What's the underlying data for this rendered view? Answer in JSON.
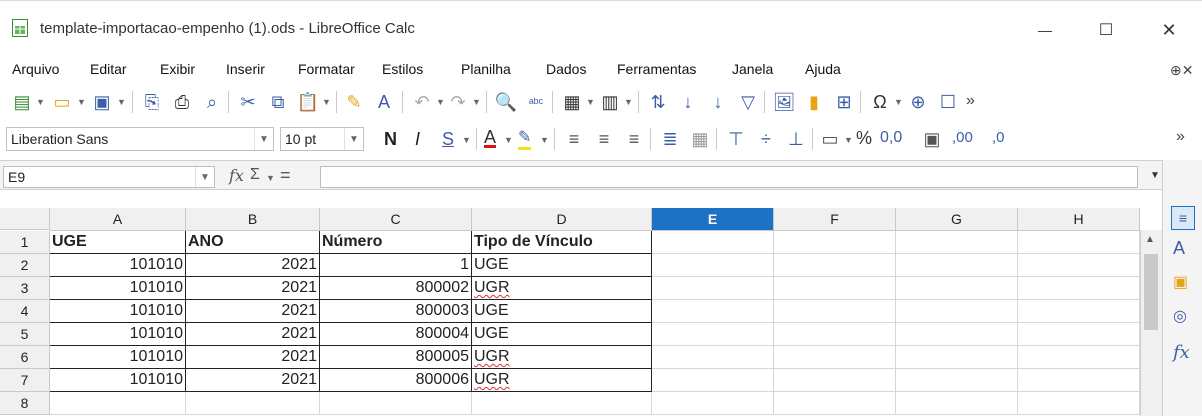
{
  "window": {
    "title": "template-importacao-empenho (1).ods - LibreOffice Calc",
    "controls": {
      "minimize": "—",
      "maximize": "☐",
      "close": "✕"
    }
  },
  "menu": [
    {
      "label": "Arquivo"
    },
    {
      "label": "Editar"
    },
    {
      "label": "Exibir"
    },
    {
      "label": "Inserir"
    },
    {
      "label": "Formatar"
    },
    {
      "label": "Estilos"
    },
    {
      "label": "Planilha"
    },
    {
      "label": "Dados"
    },
    {
      "label": "Ferramentas"
    },
    {
      "label": "Janela"
    },
    {
      "label": "Ajuda"
    }
  ],
  "formatting": {
    "font_name": "Liberation Sans",
    "font_size": "10 pt",
    "bold": "N",
    "italic": "I",
    "underline": "S",
    "percent": "%",
    "decimal_format": "0,0",
    "add_decimal": ",00",
    "del_decimal": ",0"
  },
  "formula_bar": {
    "cell_ref": "E9",
    "fx": "fx",
    "sum": "Σ",
    "equals": "=",
    "content": ""
  },
  "grid": {
    "columns": [
      "A",
      "B",
      "C",
      "D",
      "E",
      "F",
      "G",
      "H"
    ],
    "selected_column": "E",
    "rows": [
      {
        "num": "1",
        "cells": [
          "UGE",
          "ANO",
          "Número",
          "Tipo de Vínculo"
        ]
      },
      {
        "num": "2",
        "cells": [
          "101010",
          "2021",
          "1",
          "UGE"
        ]
      },
      {
        "num": "3",
        "cells": [
          "101010",
          "2021",
          "800002",
          "UGR"
        ]
      },
      {
        "num": "4",
        "cells": [
          "101010",
          "2021",
          "800003",
          "UGE"
        ]
      },
      {
        "num": "5",
        "cells": [
          "101010",
          "2021",
          "800004",
          "UGE"
        ]
      },
      {
        "num": "6",
        "cells": [
          "101010",
          "2021",
          "800005",
          "UGR"
        ]
      },
      {
        "num": "7",
        "cells": [
          "101010",
          "2021",
          "800006",
          "UGR"
        ]
      },
      {
        "num": "8",
        "cells": [
          "",
          "",
          "",
          ""
        ]
      }
    ]
  },
  "colors": {
    "accent": "#1e72c5",
    "selected_header": "#1e72c5"
  }
}
